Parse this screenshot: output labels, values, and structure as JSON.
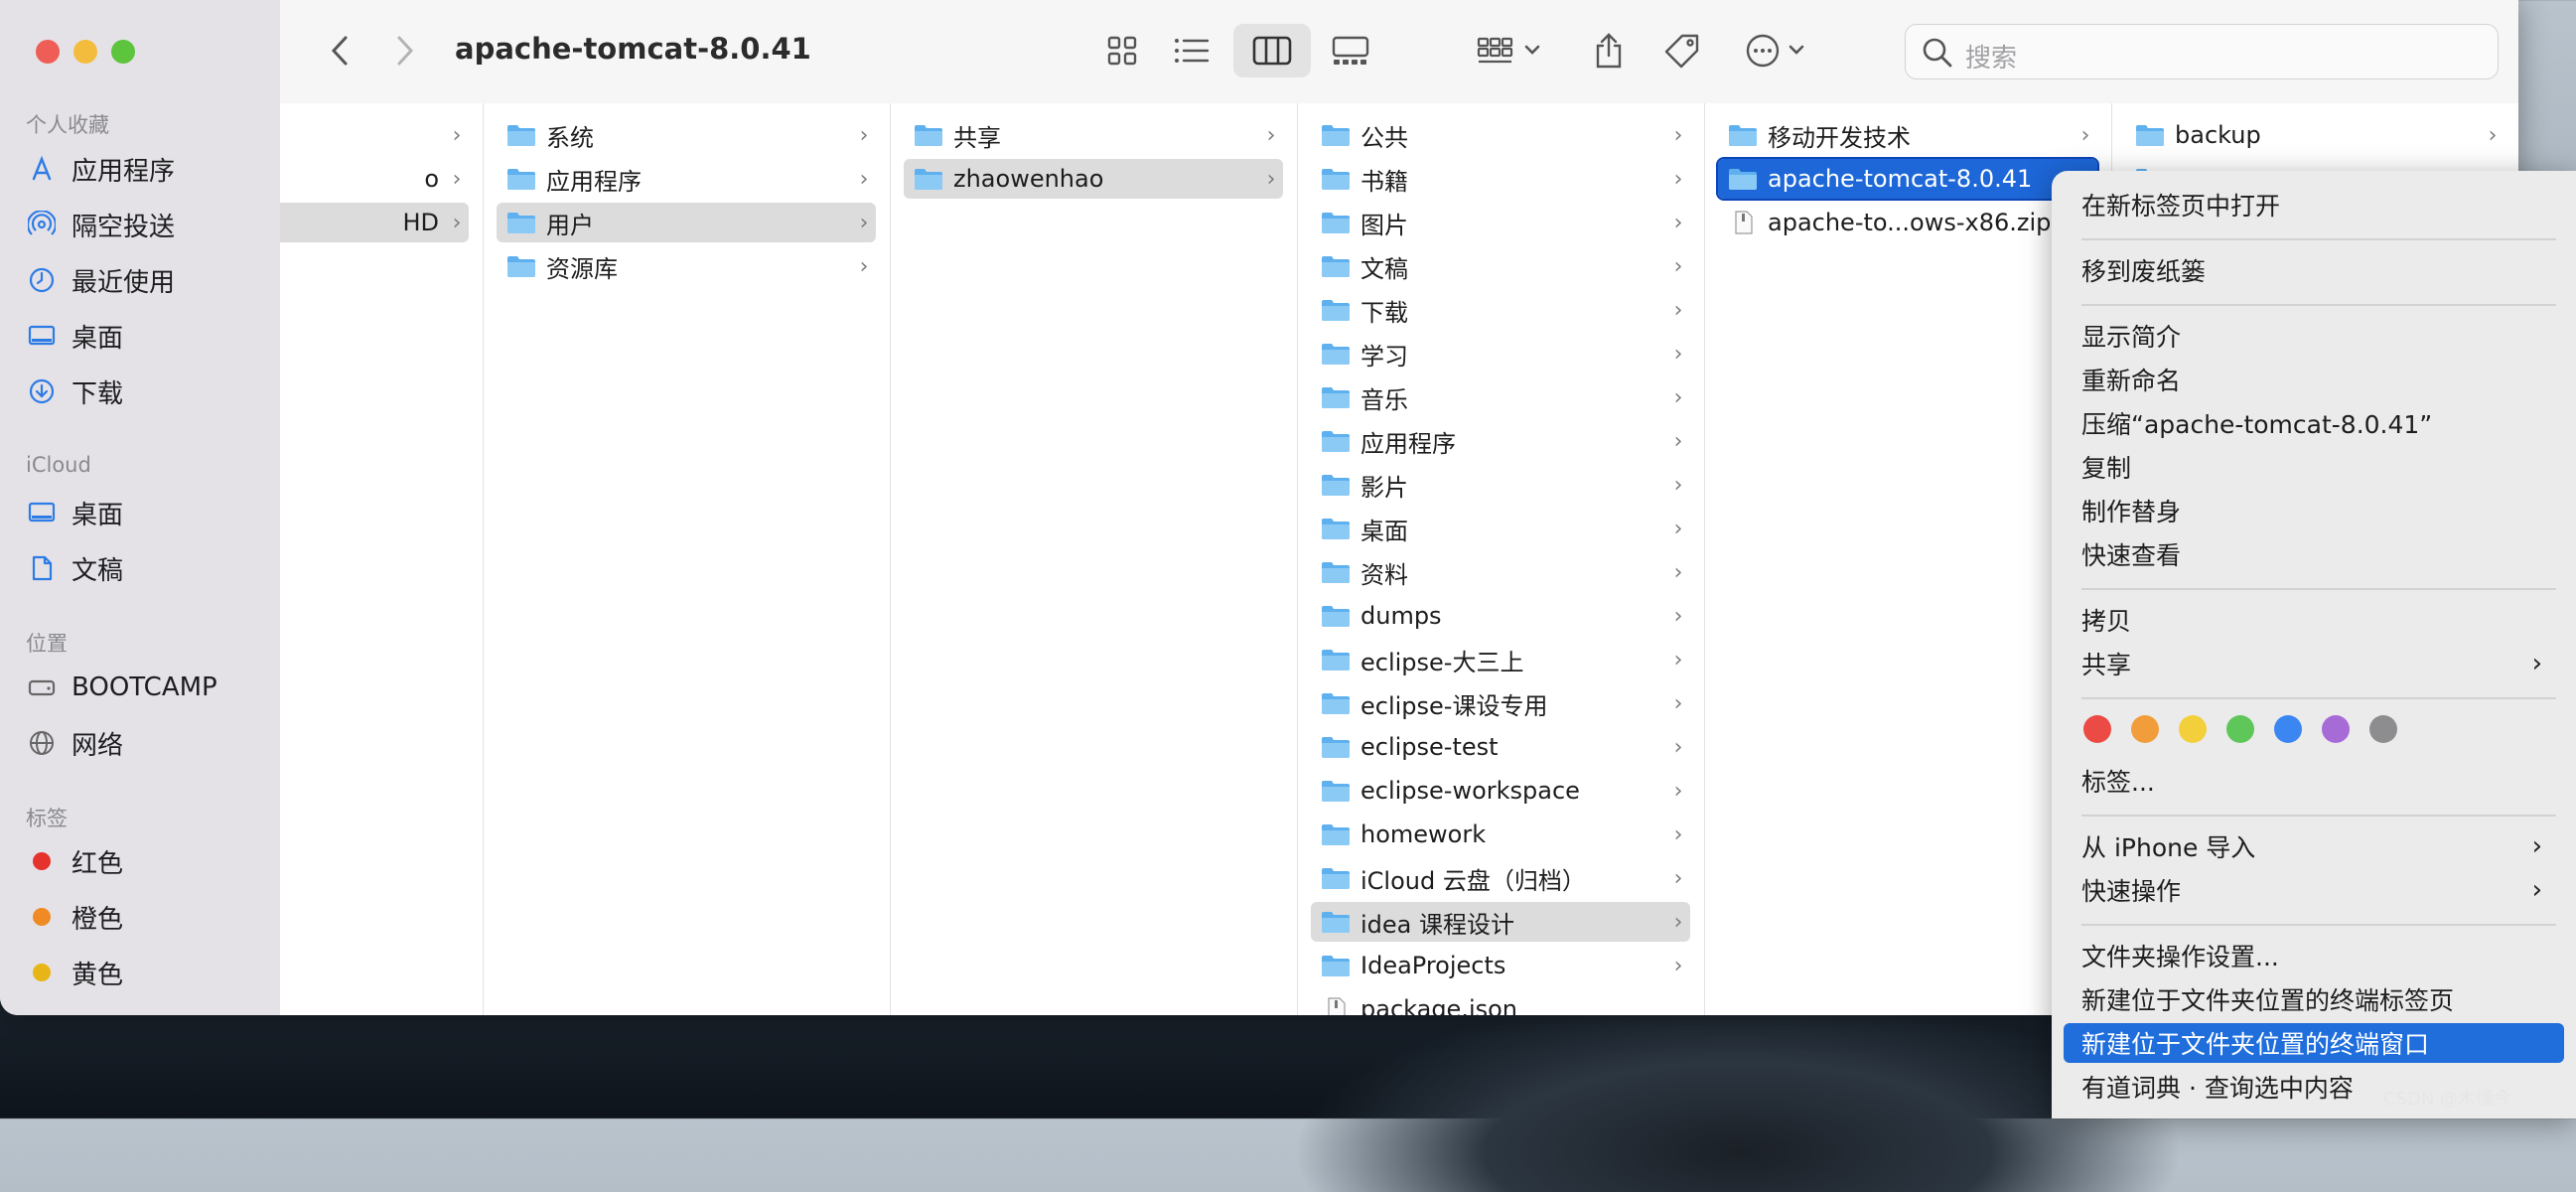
{
  "window": {
    "title": "apache-tomcat-8.0.41"
  },
  "search": {
    "placeholder": "搜索"
  },
  "sidebar": {
    "favorites_title": "个人收藏",
    "favorites": [
      {
        "label": "应用程序",
        "icon": "apps-icon"
      },
      {
        "label": "隔空投送",
        "icon": "airdrop-icon"
      },
      {
        "label": "最近使用",
        "icon": "clock-icon"
      },
      {
        "label": "桌面",
        "icon": "desktop-icon"
      },
      {
        "label": "下载",
        "icon": "download-icon"
      }
    ],
    "icloud_title": "iCloud",
    "icloud": [
      {
        "label": "桌面",
        "icon": "desktop-icon"
      },
      {
        "label": "文稿",
        "icon": "document-icon"
      }
    ],
    "locations_title": "位置",
    "locations": [
      {
        "label": "BOOTCAMP",
        "icon": "drive-icon"
      },
      {
        "label": "网络",
        "icon": "globe-icon"
      }
    ],
    "tags_title": "标签",
    "tags": [
      {
        "label": "红色",
        "color": "#e5322d"
      },
      {
        "label": "橙色",
        "color": "#f08a24"
      },
      {
        "label": "黄色",
        "color": "#e8b516"
      }
    ]
  },
  "columns": [
    {
      "items": [
        {
          "label": "",
          "chevron": true
        },
        {
          "label": "o",
          "chevron": true
        },
        {
          "label": "HD",
          "chevron": true,
          "state": "sel"
        }
      ]
    },
    {
      "items": [
        {
          "label": "系统",
          "chevron": true
        },
        {
          "label": "应用程序",
          "chevron": true
        },
        {
          "label": "用户",
          "chevron": true,
          "state": "sel"
        },
        {
          "label": "资源库",
          "chevron": true
        }
      ]
    },
    {
      "items": [
        {
          "label": "共享",
          "chevron": true
        },
        {
          "label": "zhaowenhao",
          "chevron": true,
          "state": "sel"
        }
      ]
    },
    {
      "items": [
        {
          "label": "公共",
          "chevron": true
        },
        {
          "label": "书籍",
          "chevron": true
        },
        {
          "label": "图片",
          "chevron": true
        },
        {
          "label": "文稿",
          "chevron": true
        },
        {
          "label": "下载",
          "chevron": true
        },
        {
          "label": "学习",
          "chevron": true
        },
        {
          "label": "音乐",
          "chevron": true
        },
        {
          "label": "应用程序",
          "chevron": true
        },
        {
          "label": "影片",
          "chevron": true
        },
        {
          "label": "桌面",
          "chevron": true
        },
        {
          "label": "资料",
          "chevron": true
        },
        {
          "label": "dumps",
          "chevron": true
        },
        {
          "label": "eclipse-大三上",
          "chevron": true
        },
        {
          "label": "eclipse-课设专用",
          "chevron": true
        },
        {
          "label": "eclipse-test",
          "chevron": true
        },
        {
          "label": "eclipse-workspace",
          "chevron": true
        },
        {
          "label": "homework",
          "chevron": true
        },
        {
          "label": "iCloud 云盘（归档）",
          "chevron": true
        },
        {
          "label": "idea 课程设计",
          "chevron": true,
          "state": "sel"
        },
        {
          "label": "IdeaProjects",
          "chevron": true
        },
        {
          "label": "package.json",
          "chevron": false,
          "file": true
        }
      ]
    },
    {
      "items": [
        {
          "label": "移动开发技术",
          "chevron": true
        },
        {
          "label": "apache-tomcat-8.0.41",
          "chevron": false,
          "state": "act"
        },
        {
          "label": "apache-to...ows-x86.zip",
          "chevron": false,
          "file": true
        }
      ]
    },
    {
      "items": [
        {
          "label": "backup",
          "chevron": true
        },
        {
          "label": "",
          "chevron": false
        }
      ]
    }
  ],
  "context_menu": {
    "items": [
      {
        "label": "在新标签页中打开"
      },
      {
        "sep": true
      },
      {
        "label": "移到废纸篓"
      },
      {
        "sep": true
      },
      {
        "label": "显示简介"
      },
      {
        "label": "重新命名"
      },
      {
        "label": "压缩“apache-tomcat-8.0.41”"
      },
      {
        "label": "复制"
      },
      {
        "label": "制作替身"
      },
      {
        "label": "快速查看"
      },
      {
        "sep": true
      },
      {
        "label": "拷贝"
      },
      {
        "label": "共享",
        "submenu": true
      },
      {
        "sep": true
      },
      {
        "tags": true
      },
      {
        "label": "标签..."
      },
      {
        "sep": true
      },
      {
        "label": "从 iPhone 导入",
        "submenu": true
      },
      {
        "label": "快速操作",
        "submenu": true
      },
      {
        "sep": true
      },
      {
        "label": "文件夹操作设置..."
      },
      {
        "label": "新建位于文件夹位置的终端标签页"
      },
      {
        "label": "新建位于文件夹位置的终端窗口",
        "highlighted": true
      },
      {
        "label": "有道词典 · 查询选中内容"
      }
    ],
    "tag_colors": [
      "#ec4a44",
      "#f29d3c",
      "#f4cf3c",
      "#5fc65a",
      "#3b86f0",
      "#a76bd8",
      "#8d8d8f"
    ]
  },
  "watermark": "CSDN @木懂今"
}
